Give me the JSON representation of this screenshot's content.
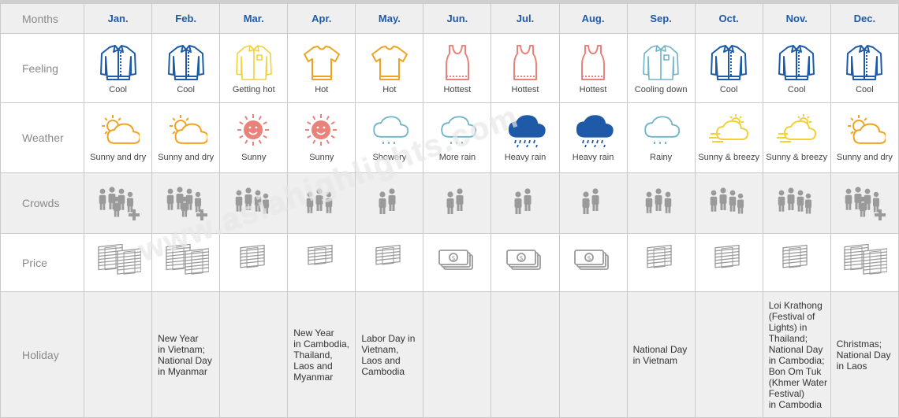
{
  "row_labels": {
    "months": "Months",
    "feeling": "Feeling",
    "weather": "Weather",
    "crowds": "Crowds",
    "price": "Price",
    "holiday": "Holiday"
  },
  "months": [
    "Jan.",
    "Feb.",
    "Mar.",
    "Apr.",
    "May.",
    "Jun.",
    "Jul.",
    "Aug.",
    "Sep.",
    "Oct.",
    "Nov.",
    "Dec."
  ],
  "feeling": [
    {
      "label": "Cool",
      "icon": "jacket-icon",
      "color": "#1f5aa8"
    },
    {
      "label": "Cool",
      "icon": "jacket-icon",
      "color": "#1f5aa8"
    },
    {
      "label": "Getting hot",
      "icon": "shirt-icon",
      "color": "#f2d13a"
    },
    {
      "label": "Hot",
      "icon": "tshirt-icon",
      "color": "#f0a322"
    },
    {
      "label": "Hot",
      "icon": "tshirt-icon",
      "color": "#f0a322"
    },
    {
      "label": "Hottest",
      "icon": "tanktop-icon",
      "color": "#e8827a"
    },
    {
      "label": "Hottest",
      "icon": "tanktop-icon",
      "color": "#e8827a"
    },
    {
      "label": "Hottest",
      "icon": "tanktop-icon",
      "color": "#e8827a"
    },
    {
      "label": "Cooling down",
      "icon": "shirt-icon",
      "color": "#6fb3c8"
    },
    {
      "label": "Cool",
      "icon": "jacket-icon",
      "color": "#1f5aa8"
    },
    {
      "label": "Cool",
      "icon": "jacket-icon",
      "color": "#1f5aa8"
    },
    {
      "label": "Cool",
      "icon": "jacket-icon",
      "color": "#1f5aa8"
    }
  ],
  "weather": [
    {
      "label": "Sunny and dry",
      "icon": "sun-cloud-icon",
      "color": "#f0a322"
    },
    {
      "label": "Sunny and dry",
      "icon": "sun-cloud-icon",
      "color": "#f0a322"
    },
    {
      "label": "Sunny",
      "icon": "sun-icon",
      "color": "#e8827a"
    },
    {
      "label": "Sunny",
      "icon": "sun-icon",
      "color": "#e8827a"
    },
    {
      "label": "Showery",
      "icon": "rain-cloud-icon",
      "color": "#6fb3c8"
    },
    {
      "label": "More rain",
      "icon": "rain-cloud-icon",
      "color": "#6fb3c8"
    },
    {
      "label": "Heavy rain",
      "icon": "heavy-rain-icon",
      "color": "#1f5aa8"
    },
    {
      "label": "Heavy rain",
      "icon": "heavy-rain-icon",
      "color": "#1f5aa8"
    },
    {
      "label": "Rainy",
      "icon": "rain-cloud-icon",
      "color": "#6fb3c8"
    },
    {
      "label": "Sunny & breezy",
      "icon": "sun-wind-icon",
      "color": "#f2d13a"
    },
    {
      "label": "Sunny & breezy",
      "icon": "sun-wind-icon",
      "color": "#f2d13a"
    },
    {
      "label": "Sunny and dry",
      "icon": "sun-cloud-icon",
      "color": "#f0a322"
    }
  ],
  "crowds": [
    {
      "level": 5,
      "icon": "crowd-plus-icon"
    },
    {
      "level": 5,
      "icon": "crowd-plus-icon"
    },
    {
      "level": 4,
      "icon": "crowd-icon"
    },
    {
      "level": 3,
      "icon": "crowd-icon"
    },
    {
      "level": 2,
      "icon": "crowd-icon"
    },
    {
      "level": 2,
      "icon": "crowd-icon"
    },
    {
      "level": 2,
      "icon": "crowd-icon"
    },
    {
      "level": 2,
      "icon": "crowd-icon"
    },
    {
      "level": 3,
      "icon": "crowd-icon"
    },
    {
      "level": 4,
      "icon": "crowd-icon"
    },
    {
      "level": 4,
      "icon": "crowd-icon"
    },
    {
      "level": 5,
      "icon": "crowd-plus-icon"
    }
  ],
  "price": [
    {
      "level": 5,
      "icon": "money-stack-icon"
    },
    {
      "level": 5,
      "icon": "money-stack-icon"
    },
    {
      "level": 4,
      "icon": "money-stack-icon"
    },
    {
      "level": 3,
      "icon": "money-stack-icon"
    },
    {
      "level": 3,
      "icon": "money-stack-icon"
    },
    {
      "level": 1,
      "icon": "dollar-bills-icon"
    },
    {
      "level": 1,
      "icon": "dollar-bills-icon"
    },
    {
      "level": 1,
      "icon": "dollar-bills-icon"
    },
    {
      "level": 4,
      "icon": "money-stack-icon"
    },
    {
      "level": 4,
      "icon": "money-stack-icon"
    },
    {
      "level": 4,
      "icon": "money-stack-icon"
    },
    {
      "level": 5,
      "icon": "money-stack-icon"
    }
  ],
  "holiday": [
    "",
    "New Year\nin Vietnam;\nNational Day\nin Myanmar",
    "",
    "New Year\nin Cambodia,\nThailand,\nLaos and\nMyanmar",
    "Labor Day in\nVietnam,\nLaos and\nCambodia",
    "",
    "",
    "",
    "National Day\nin Vietnam",
    "",
    "Loi Krathong\n(Festival of\nLights) in\nThailand;\nNational Day\nin Cambodia;\nBon Om Tuk\n(Khmer Water\nFestival)\nin Cambodia",
    "Christmas;\nNational Day\nin Laos"
  ],
  "watermark": "www.asiahighlights.com",
  "colors": {
    "header_bg": "#efefef",
    "month_text": "#1f5aa8",
    "grid": "#c9c9c9",
    "icon_gray": "#9a9a9a"
  }
}
